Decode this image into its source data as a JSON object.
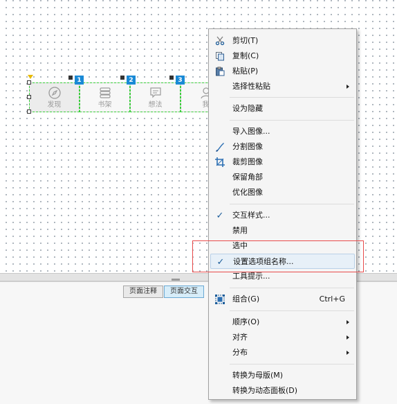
{
  "canvas": {
    "widget_group": {
      "items": [
        {
          "label": "发现",
          "icon": "compass-icon",
          "badge": ""
        },
        {
          "label": "书架",
          "icon": "book-icon",
          "badge": "1"
        },
        {
          "label": "想法",
          "icon": "chat-icon",
          "badge": "2"
        },
        {
          "label": "我",
          "icon": "person-icon",
          "badge": "3"
        }
      ]
    }
  },
  "bottom_panel": {
    "tabs": [
      {
        "label": "页面注释",
        "active": false
      },
      {
        "label": "页面交互",
        "active": true
      }
    ]
  },
  "context_menu": {
    "items": [
      {
        "label": "剪切(T)",
        "icon": "scissors-icon"
      },
      {
        "label": "复制(C)",
        "icon": "copy-icon"
      },
      {
        "label": "粘贴(P)",
        "icon": "paste-icon"
      },
      {
        "label": "选择性粘贴",
        "submenu": true
      },
      {
        "label": "设为隐藏"
      },
      {
        "label": "导入图像..."
      },
      {
        "label": "分割图像",
        "icon": "split-image-icon"
      },
      {
        "label": "裁剪图像",
        "icon": "crop-icon"
      },
      {
        "label": "保留角部"
      },
      {
        "label": "优化图像"
      },
      {
        "label": "交互样式...",
        "checked": true
      },
      {
        "label": "禁用"
      },
      {
        "label": "选中"
      },
      {
        "label": "设置选项组名称...",
        "checked": true,
        "highlighted": true
      },
      {
        "label": "工具提示..."
      },
      {
        "label": "组合(G)",
        "shortcut": "Ctrl+G",
        "icon": "group-icon"
      },
      {
        "label": "顺序(O)",
        "submenu": true
      },
      {
        "label": "对齐",
        "submenu": true
      },
      {
        "label": "分布",
        "submenu": true
      },
      {
        "label": "转换为母版(M)"
      },
      {
        "label": "转换为动态面板(D)"
      }
    ]
  },
  "colors": {
    "selection_outline": "#39d03a",
    "badge": "#1a8ad6",
    "highlight_box": "#e84a4a",
    "menu_hover": "#e7f0f8"
  }
}
